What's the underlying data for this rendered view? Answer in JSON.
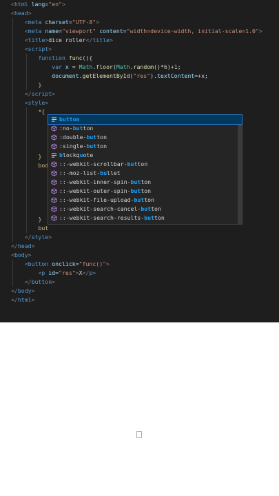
{
  "code_lines": [
    {
      "parts": [
        [
          "punc",
          "<"
        ],
        [
          "tag",
          "html"
        ],
        [
          "txt",
          " "
        ],
        [
          "attr",
          "lang"
        ],
        [
          "txt",
          "="
        ],
        [
          "str",
          "\"en\""
        ],
        [
          "punc",
          ">"
        ]
      ]
    },
    {
      "parts": [
        [
          "punc",
          "<"
        ],
        [
          "tag",
          "head"
        ],
        [
          "punc",
          ">"
        ]
      ]
    },
    {
      "parts": [
        [
          "txt",
          "    "
        ],
        [
          "punc",
          "<"
        ],
        [
          "tag",
          "meta"
        ],
        [
          "txt",
          " "
        ],
        [
          "attr",
          "charset"
        ],
        [
          "txt",
          "="
        ],
        [
          "str",
          "\"UTF-8\""
        ],
        [
          "punc",
          ">"
        ]
      ]
    },
    {
      "parts": [
        [
          "txt",
          "    "
        ],
        [
          "punc",
          "<"
        ],
        [
          "tag",
          "meta"
        ],
        [
          "txt",
          " "
        ],
        [
          "attr",
          "name"
        ],
        [
          "txt",
          "="
        ],
        [
          "str",
          "\"viewport\""
        ],
        [
          "txt",
          " "
        ],
        [
          "attr",
          "content"
        ],
        [
          "txt",
          "="
        ],
        [
          "str",
          "\"width=device-width, initial-scale=1.0\""
        ],
        [
          "punc",
          ">"
        ]
      ]
    },
    {
      "parts": [
        [
          "txt",
          "    "
        ],
        [
          "punc",
          "<"
        ],
        [
          "tag",
          "title"
        ],
        [
          "punc",
          ">"
        ],
        [
          "txt",
          "dice roller"
        ],
        [
          "punc",
          "</"
        ],
        [
          "tag",
          "title"
        ],
        [
          "punc",
          ">"
        ]
      ]
    },
    {
      "parts": [
        [
          "txt",
          "    "
        ],
        [
          "punc",
          "<"
        ],
        [
          "tag",
          "script"
        ],
        [
          "punc",
          ">"
        ]
      ]
    },
    {
      "parts": [
        [
          "txt",
          "        "
        ],
        [
          "kw",
          "function"
        ],
        [
          "txt",
          " "
        ],
        [
          "fn",
          "func"
        ],
        [
          "txt",
          "(){"
        ]
      ]
    },
    {
      "parts": [
        [
          "txt",
          "            "
        ],
        [
          "kw",
          "var"
        ],
        [
          "txt",
          " "
        ],
        [
          "attr",
          "x"
        ],
        [
          "txt",
          " = "
        ],
        [
          "obj",
          "Math"
        ],
        [
          "txt",
          "."
        ],
        [
          "fn",
          "floor"
        ],
        [
          "txt",
          "("
        ],
        [
          "obj",
          "Math"
        ],
        [
          "txt",
          "."
        ],
        [
          "fn",
          "random"
        ],
        [
          "txt",
          "()*"
        ],
        [
          "num",
          "6"
        ],
        [
          "txt",
          ")+"
        ],
        [
          "num",
          "1"
        ],
        [
          "txt",
          ";"
        ]
      ]
    },
    {
      "parts": [
        [
          "txt",
          "            "
        ],
        [
          "attr",
          "document"
        ],
        [
          "txt",
          "."
        ],
        [
          "fn",
          "getElementById"
        ],
        [
          "txt",
          "("
        ],
        [
          "str",
          "\"res\""
        ],
        [
          "txt",
          ")."
        ],
        [
          "attr",
          "textContent"
        ],
        [
          "txt",
          "=+"
        ],
        [
          "attr",
          "x"
        ],
        [
          "txt",
          ";"
        ]
      ]
    },
    {
      "parts": [
        [
          "txt",
          "        "
        ],
        [
          "yel",
          "}"
        ]
      ]
    },
    {
      "parts": [
        [
          "txt",
          "    "
        ],
        [
          "punc",
          "</"
        ],
        [
          "tag",
          "script"
        ],
        [
          "punc",
          ">"
        ]
      ]
    },
    {
      "parts": [
        [
          "txt",
          "    "
        ],
        [
          "punc",
          "<"
        ],
        [
          "tag",
          "style"
        ],
        [
          "punc",
          ">"
        ]
      ]
    },
    {
      "parts": [
        [
          "txt",
          "        "
        ],
        [
          "yel",
          "*{"
        ]
      ]
    },
    {
      "parts": []
    },
    {
      "parts": []
    },
    {
      "parts": []
    },
    {
      "parts": []
    },
    {
      "parts": [
        [
          "txt",
          "        "
        ],
        [
          "yel",
          "}"
        ]
      ]
    },
    {
      "parts": [
        [
          "txt",
          "        "
        ],
        [
          "yel",
          "bod"
        ]
      ]
    },
    {
      "parts": []
    },
    {
      "parts": []
    },
    {
      "parts": []
    },
    {
      "parts": []
    },
    {
      "parts": []
    },
    {
      "parts": [
        [
          "txt",
          "        "
        ],
        [
          "yel",
          "}"
        ]
      ]
    },
    {
      "parts": [
        [
          "txt",
          "        "
        ],
        [
          "yel",
          "but"
        ]
      ]
    },
    {
      "parts": [
        [
          "txt",
          "    "
        ],
        [
          "punc",
          "</"
        ],
        [
          "tag",
          "style"
        ],
        [
          "punc",
          ">"
        ]
      ]
    },
    {
      "parts": [
        [
          "punc",
          "</"
        ],
        [
          "tag",
          "head"
        ],
        [
          "punc",
          ">"
        ]
      ]
    },
    {
      "parts": [
        [
          "punc",
          "<"
        ],
        [
          "tag",
          "body"
        ],
        [
          "punc",
          ">"
        ]
      ]
    },
    {
      "parts": [
        [
          "txt",
          "    "
        ],
        [
          "punc",
          "<"
        ],
        [
          "tag",
          "button"
        ],
        [
          "txt",
          " "
        ],
        [
          "attr",
          "onclick"
        ],
        [
          "txt",
          "="
        ],
        [
          "str",
          "\"func()\""
        ],
        [
          "punc",
          ">"
        ]
      ]
    },
    {
      "parts": [
        [
          "txt",
          "        "
        ],
        [
          "punc",
          "<"
        ],
        [
          "tag",
          "p"
        ],
        [
          "txt",
          " "
        ],
        [
          "attr",
          "id"
        ],
        [
          "txt",
          "="
        ],
        [
          "str",
          "\"res\""
        ],
        [
          "punc",
          ">"
        ],
        [
          "txt",
          "X"
        ],
        [
          "punc",
          "</"
        ],
        [
          "tag",
          "p"
        ],
        [
          "punc",
          ">"
        ]
      ]
    },
    {
      "parts": [
        [
          "txt",
          "    "
        ],
        [
          "punc",
          "</"
        ],
        [
          "tag",
          "button"
        ],
        [
          "punc",
          ">"
        ]
      ]
    },
    {
      "parts": [
        [
          "punc",
          "</"
        ],
        [
          "tag",
          "body"
        ],
        [
          "punc",
          ">"
        ]
      ]
    },
    {
      "parts": [
        [
          "punc",
          "</"
        ],
        [
          "tag",
          "html"
        ],
        [
          "punc",
          ">"
        ]
      ]
    }
  ],
  "suggestions": [
    {
      "icon": "snippet-icon",
      "pre": "",
      "hl": "button",
      "post": "",
      "selected": true
    },
    {
      "icon": "cube-icon",
      "pre": ":no-",
      "hl": "but",
      "post": "ton",
      "selected": false
    },
    {
      "icon": "cube-icon",
      "pre": ":double-",
      "hl": "but",
      "post": "ton",
      "selected": false
    },
    {
      "icon": "cube-icon",
      "pre": ":single-",
      "hl": "but",
      "post": "ton",
      "selected": false
    },
    {
      "icon": "snippet-icon",
      "pre": "",
      "hl": "b",
      "post": "lockq",
      "hl2": "u",
      "post2": "ote",
      "selected": false
    },
    {
      "icon": "cube-icon",
      "pre": "::-webkit-scrollbar-",
      "hl": "but",
      "post": "ton",
      "selected": false
    },
    {
      "icon": "cube-icon",
      "pre": "::-moz-list-",
      "hl": "bu",
      "post": "llet",
      "selected": false
    },
    {
      "icon": "cube-icon",
      "pre": "::-webkit-inner-spin-",
      "hl": "but",
      "post": "ton",
      "selected": false
    },
    {
      "icon": "cube-icon",
      "pre": "::-webkit-outer-spin-",
      "hl": "but",
      "post": "ton",
      "selected": false
    },
    {
      "icon": "cube-icon",
      "pre": "::-webkit-file-upload-",
      "hl": "but",
      "post": "ton",
      "selected": false
    },
    {
      "icon": "cube-icon",
      "pre": "::-webkit-search-cancel-",
      "hl": "but",
      "post": "ton",
      "selected": false
    },
    {
      "icon": "cube-icon",
      "pre": "::-webkit-search-results-",
      "hl": "but",
      "post": "ton",
      "selected": false
    }
  ],
  "colors": {
    "editor_bg": "#1e1e1e",
    "highlight": "#18a3ff",
    "selection": "#04395e"
  }
}
